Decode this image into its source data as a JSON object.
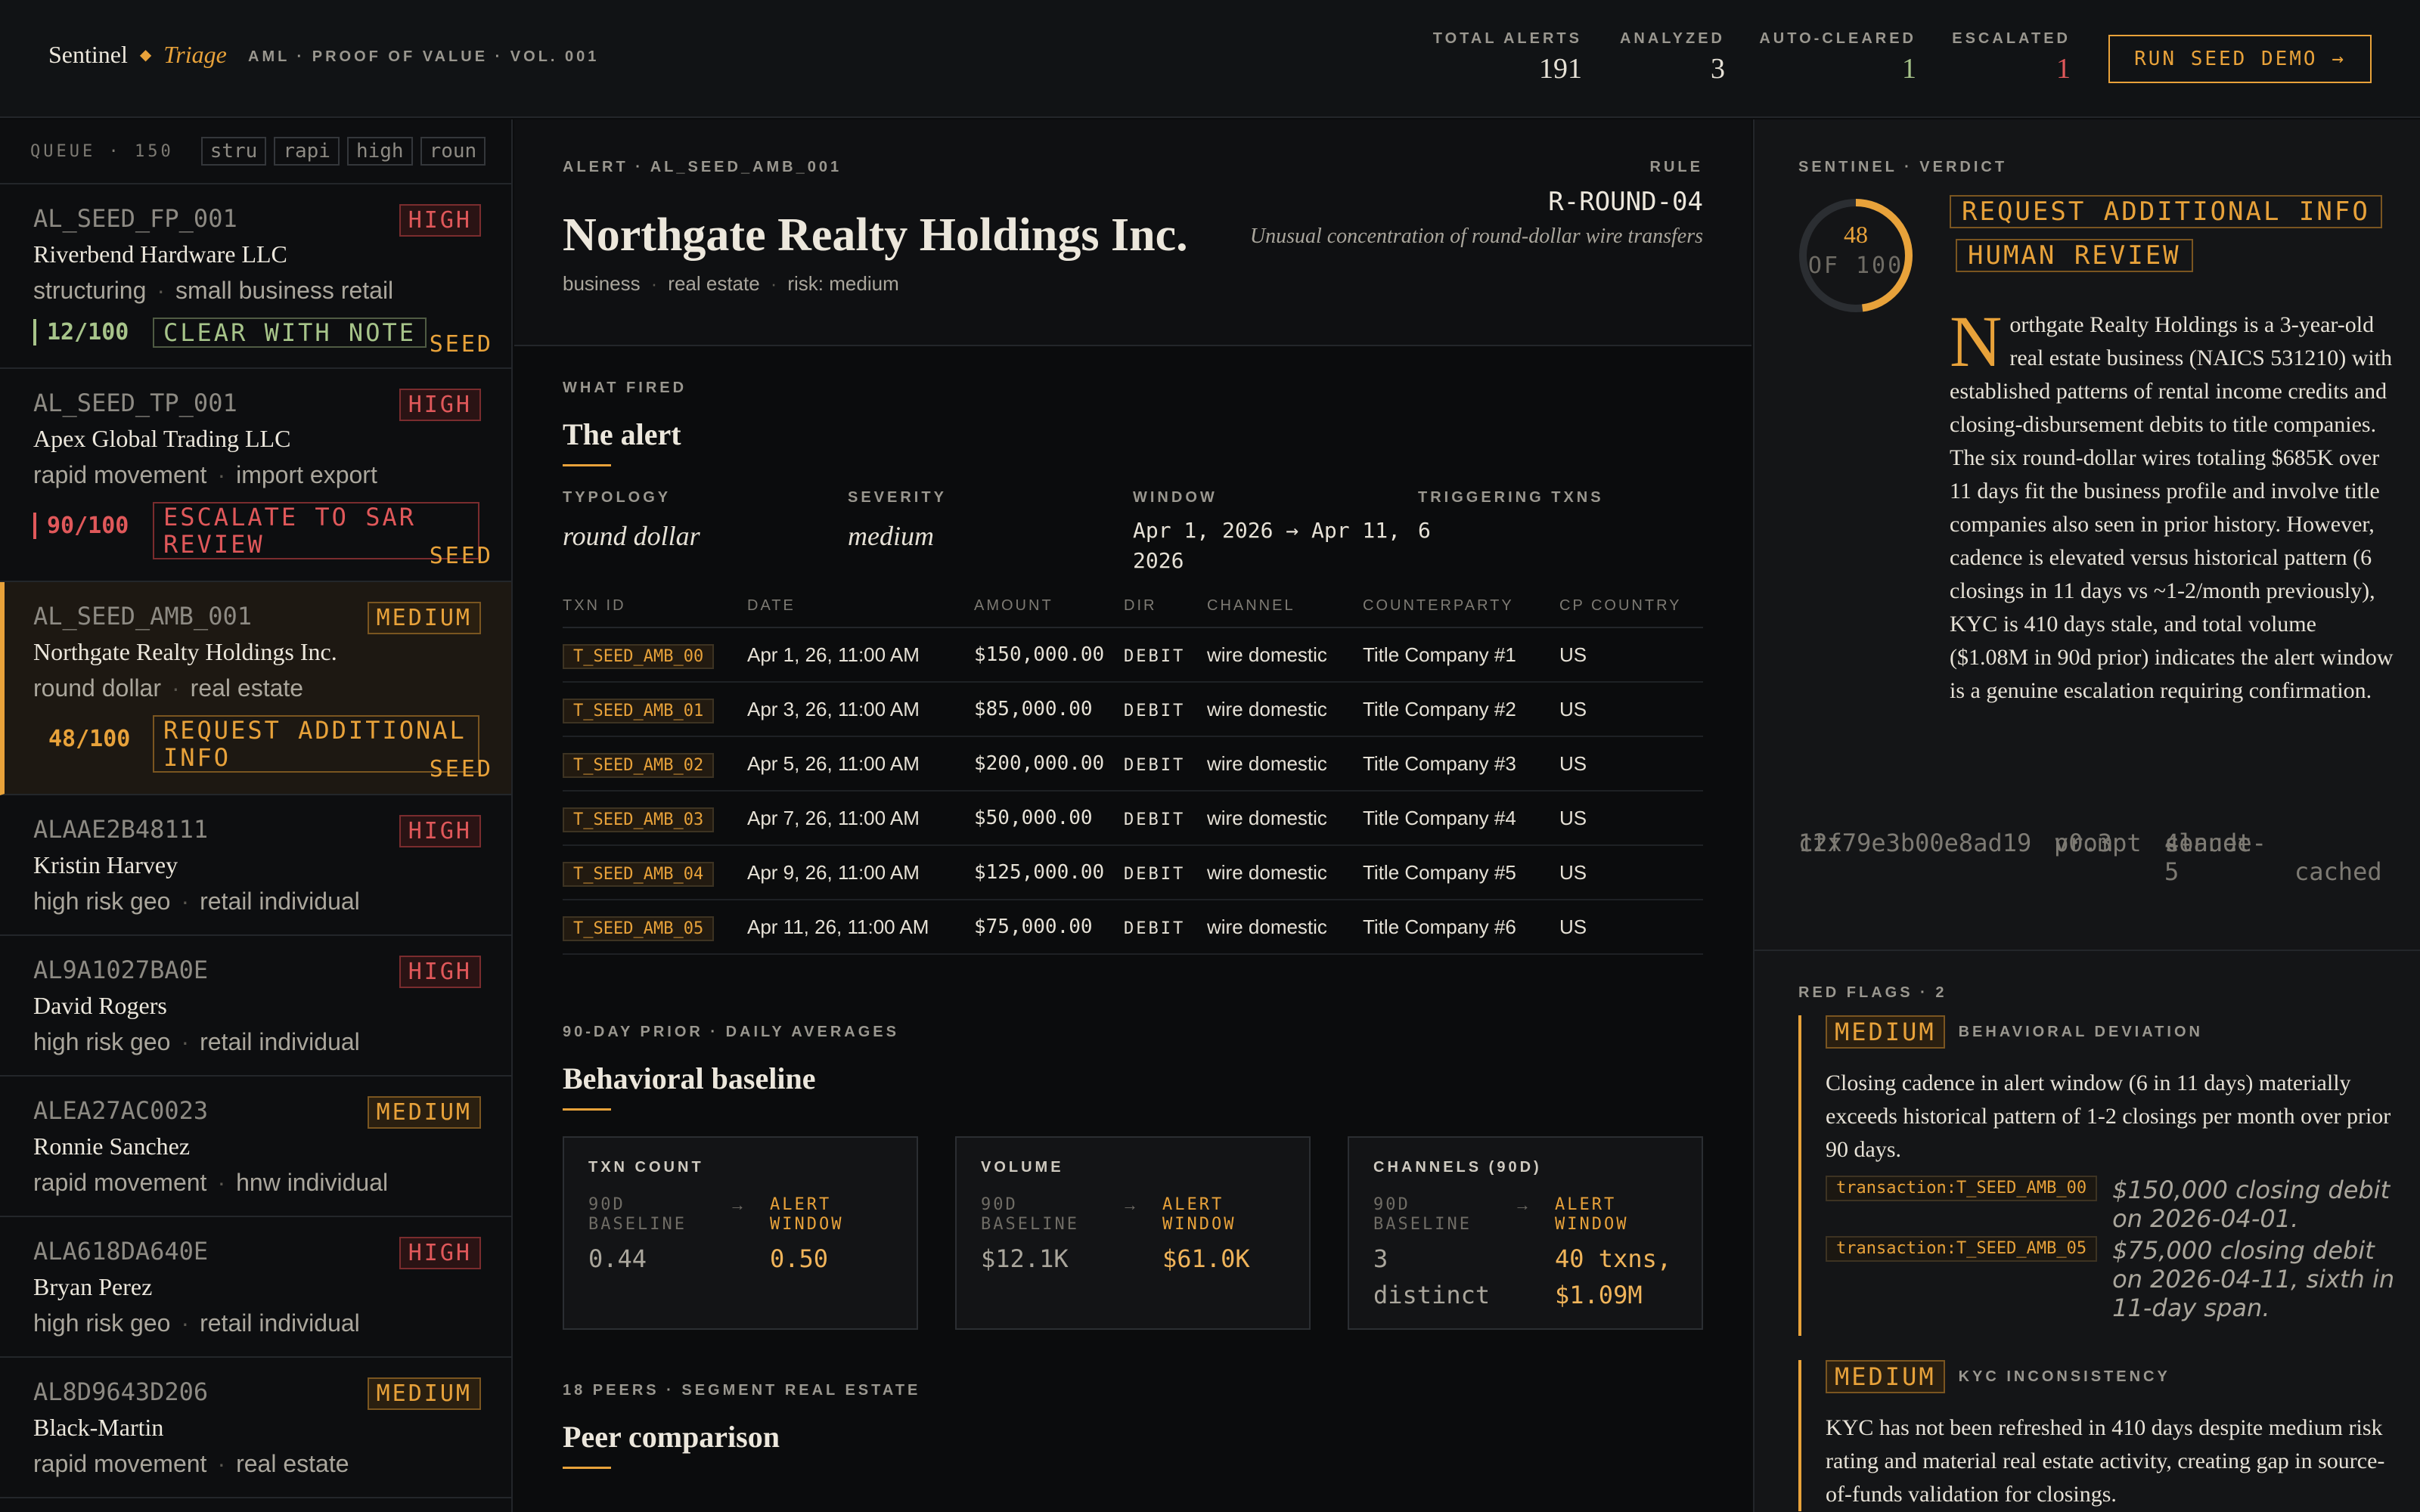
{
  "header": {
    "brand_primary": "Sentinel",
    "brand_secondary": "Triage",
    "subtitle": "AML · PROOF OF VALUE · VOL. 001",
    "stats": [
      {
        "label": "TOTAL ALERTS",
        "value": "191",
        "color": "#e6e1d6"
      },
      {
        "label": "ANALYZED",
        "value": "3",
        "color": "#e6e1d6"
      },
      {
        "label": "AUTO-CLEARED",
        "value": "1",
        "color": "#a7c48a"
      },
      {
        "label": "ESCALATED",
        "value": "1",
        "color": "#e0585a"
      }
    ],
    "demo_button": "RUN SEED DEMO →"
  },
  "queue": {
    "label": "QUEUE · 150",
    "chips": [
      "stru",
      "rapi",
      "high",
      "roun"
    ],
    "items": [
      {
        "id": "AL_SEED_FP_001",
        "severity": "HIGH",
        "name": "Riverbend Hardware LLC",
        "tag1": "structuring",
        "tag2": "small business retail",
        "score": "12/100",
        "verdict": "CLEAR WITH NOTE",
        "seed": "SEED"
      },
      {
        "id": "AL_SEED_TP_001",
        "severity": "HIGH",
        "name": "Apex Global Trading LLC",
        "tag1": "rapid movement",
        "tag2": "import export",
        "score": "90/100",
        "verdict_l1": "ESCALATE TO SAR",
        "verdict_l2": "REVIEW",
        "seed": "SEED"
      },
      {
        "id": "AL_SEED_AMB_001",
        "severity": "MEDIUM",
        "name": "Northgate Realty Holdings Inc.",
        "tag1": "round dollar",
        "tag2": "real estate",
        "score": "48/100",
        "verdict_l1": "REQUEST ADDITIONAL",
        "verdict_l2": "INFO",
        "seed": "SEED"
      },
      {
        "id": "ALAAE2B48111",
        "severity": "HIGH",
        "name": "Kristin Harvey",
        "tag1": "high risk geo",
        "tag2": "retail individual"
      },
      {
        "id": "AL9A1027BA0E",
        "severity": "HIGH",
        "name": "David Rogers",
        "tag1": "high risk geo",
        "tag2": "retail individual"
      },
      {
        "id": "ALEA27AC0023",
        "severity": "MEDIUM",
        "name": "Ronnie Sanchez",
        "tag1": "rapid movement",
        "tag2": "hnw individual"
      },
      {
        "id": "ALA618DA640E",
        "severity": "HIGH",
        "name": "Bryan Perez",
        "tag1": "high risk geo",
        "tag2": "retail individual"
      },
      {
        "id": "AL8D9643D206",
        "severity": "MEDIUM",
        "name": "Black-Martin",
        "tag1": "rapid movement",
        "tag2": "real estate"
      }
    ]
  },
  "alert": {
    "eyebrow": "ALERT · AL_SEED_AMB_001",
    "title": "Northgate Realty Holdings Inc.",
    "meta": [
      "business",
      "real estate",
      "risk: medium"
    ],
    "rule_label": "RULE",
    "rule_code": "R-ROUND-04",
    "rule_desc": "Unusual concentration of round-dollar wire transfers"
  },
  "what_fired": {
    "eyebrow": "WHAT FIRED",
    "title": "The alert",
    "facts": [
      {
        "label": "TYPOLOGY",
        "value": "round dollar"
      },
      {
        "label": "SEVERITY",
        "value": "medium"
      },
      {
        "label": "WINDOW",
        "value_l1": "Apr 1, 2026 → Apr 11,",
        "value_l2": "2026"
      },
      {
        "label": "TRIGGERING TXNS",
        "value": "6"
      }
    ],
    "columns": [
      "TXN ID",
      "DATE",
      "AMOUNT",
      "DIR",
      "CHANNEL",
      "COUNTERPARTY",
      "CP COUNTRY"
    ],
    "rows": [
      [
        "T_SEED_AMB_00",
        "Apr 1, 26, 11:00 AM",
        "$150,000.00",
        "DEBIT",
        "wire domestic",
        "Title Company #1",
        "US"
      ],
      [
        "T_SEED_AMB_01",
        "Apr 3, 26, 11:00 AM",
        "$85,000.00",
        "DEBIT",
        "wire domestic",
        "Title Company #2",
        "US"
      ],
      [
        "T_SEED_AMB_02",
        "Apr 5, 26, 11:00 AM",
        "$200,000.00",
        "DEBIT",
        "wire domestic",
        "Title Company #3",
        "US"
      ],
      [
        "T_SEED_AMB_03",
        "Apr 7, 26, 11:00 AM",
        "$50,000.00",
        "DEBIT",
        "wire domestic",
        "Title Company #4",
        "US"
      ],
      [
        "T_SEED_AMB_04",
        "Apr 9, 26, 11:00 AM",
        "$125,000.00",
        "DEBIT",
        "wire domestic",
        "Title Company #5",
        "US"
      ],
      [
        "T_SEED_AMB_05",
        "Apr 11, 26, 11:00 AM",
        "$75,000.00",
        "DEBIT",
        "wire domestic",
        "Title Company #6",
        "US"
      ]
    ]
  },
  "baseline": {
    "eyebrow": "90-DAY PRIOR · DAILY AVERAGES",
    "title": "Behavioral baseline",
    "baseline_label_l1": "90D",
    "baseline_label_l2": "BASELINE",
    "alert_label_l1": "ALERT",
    "alert_label_l2": "WINDOW",
    "arrow": "→",
    "cards": [
      {
        "label": "TXN COUNT",
        "baseline": "0.44",
        "alert": "0.50"
      },
      {
        "label": "VOLUME",
        "baseline": "$12.1K",
        "alert": "$61.0K"
      },
      {
        "label": "CHANNELS (90D)",
        "baseline_l1": "3",
        "baseline_l2": "distinct",
        "alert_l1": "40 txns,",
        "alert_l2": "$1.09M"
      }
    ]
  },
  "peers": {
    "eyebrow": "18 PEERS · SEGMENT REAL ESTATE",
    "title": "Peer comparison"
  },
  "verdict": {
    "eyebrow": "SENTINEL · VERDICT",
    "score": 48,
    "score_text": "48",
    "of_text": "OF 100",
    "tag1": "REQUEST ADDITIONAL INFO",
    "tag2": "HUMAN REVIEW",
    "dropcap": "N",
    "narrative": "orthgate Realty Holdings is a 3-year-old real estate business (NAICS 531210) with established patterns of rental income credits and closing-disbursement debits to title companies. The six round-dollar wires totaling $685K over 11 days fit the business profile and involve title companies also seen in prior history. However, cadence is elevated versus historical pattern (6 closings in 11 days vs ~1-2/month previously), KYC is 410 days stale, and total volume ($1.08M in 90d prior) indicates the alert window is a genuine escalation requiring confirmation.",
    "ctx_l1": "ctx",
    "ctx_l2": "12f79e3b00e8ad19",
    "prompt_l1": "prompt",
    "prompt_l2": "v0.3",
    "model_l1": "claude-",
    "model_l2": "sonnet-",
    "model_l3": "4-5",
    "cached": "cached"
  },
  "red_flags": {
    "eyebrow": "RED FLAGS · 2",
    "flags": [
      {
        "severity": "MEDIUM",
        "type": "BEHAVIORAL DEVIATION",
        "body": "Closing cadence in alert window (6 in 11 days) materially exceeds historical pattern of 1-2 closings per month over prior 90 days.",
        "evidence": [
          {
            "tag": "transaction:T_SEED_AMB_00",
            "text": "$150,000 closing debit on 2026-04-01."
          },
          {
            "tag": "transaction:T_SEED_AMB_05",
            "text": "$75,000 closing debit on 2026-04-11, sixth in 11-day span."
          }
        ]
      },
      {
        "severity": "MEDIUM",
        "type": "KYC INCONSISTENCY",
        "body": "KYC has not been refreshed in 410 days despite medium risk rating and material real estate activity, creating gap in source-of-funds validation for closings."
      }
    ]
  }
}
